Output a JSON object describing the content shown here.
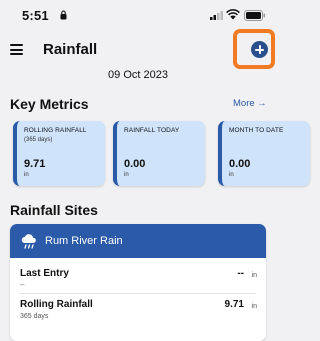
{
  "status_bar": {
    "time": "5:51",
    "icons": [
      "lock-icon",
      "signal-icon",
      "wifi-icon",
      "battery-icon"
    ]
  },
  "header": {
    "title": "Rainfall",
    "menu_icon": "hamburger-menu-icon",
    "add_icon": "plus-circle-icon",
    "date": "09 Oct 2023"
  },
  "key_metrics": {
    "title": "Key Metrics",
    "more_label": "More →",
    "cards": [
      {
        "label": "ROLLING RAINFALL",
        "sublabel": "(365 days)",
        "value": "9.71",
        "unit": "in"
      },
      {
        "label": "RAINFALL TODAY",
        "sublabel": "",
        "value": "0.00",
        "unit": "in"
      },
      {
        "label": "MONTH TO DATE",
        "sublabel": "",
        "value": "0.00",
        "unit": "in"
      }
    ]
  },
  "rainfall_sites": {
    "title": "Rainfall Sites",
    "sites": [
      {
        "name": "Rum River Rain",
        "icon": "rain-cloud-icon",
        "last_entry_label": "Last Entry",
        "last_entry_sub": "--",
        "last_entry_value": "--",
        "last_entry_unit": "in",
        "rolling_label": "Rolling Rainfall",
        "rolling_sub": "365 days",
        "rolling_value": "9.71",
        "rolling_unit": "in"
      }
    ]
  },
  "colors": {
    "background": "#f1f1f3",
    "accent": "#2b5aa8",
    "card_fill": "#cfe3fa",
    "highlight": "#f07b22"
  }
}
